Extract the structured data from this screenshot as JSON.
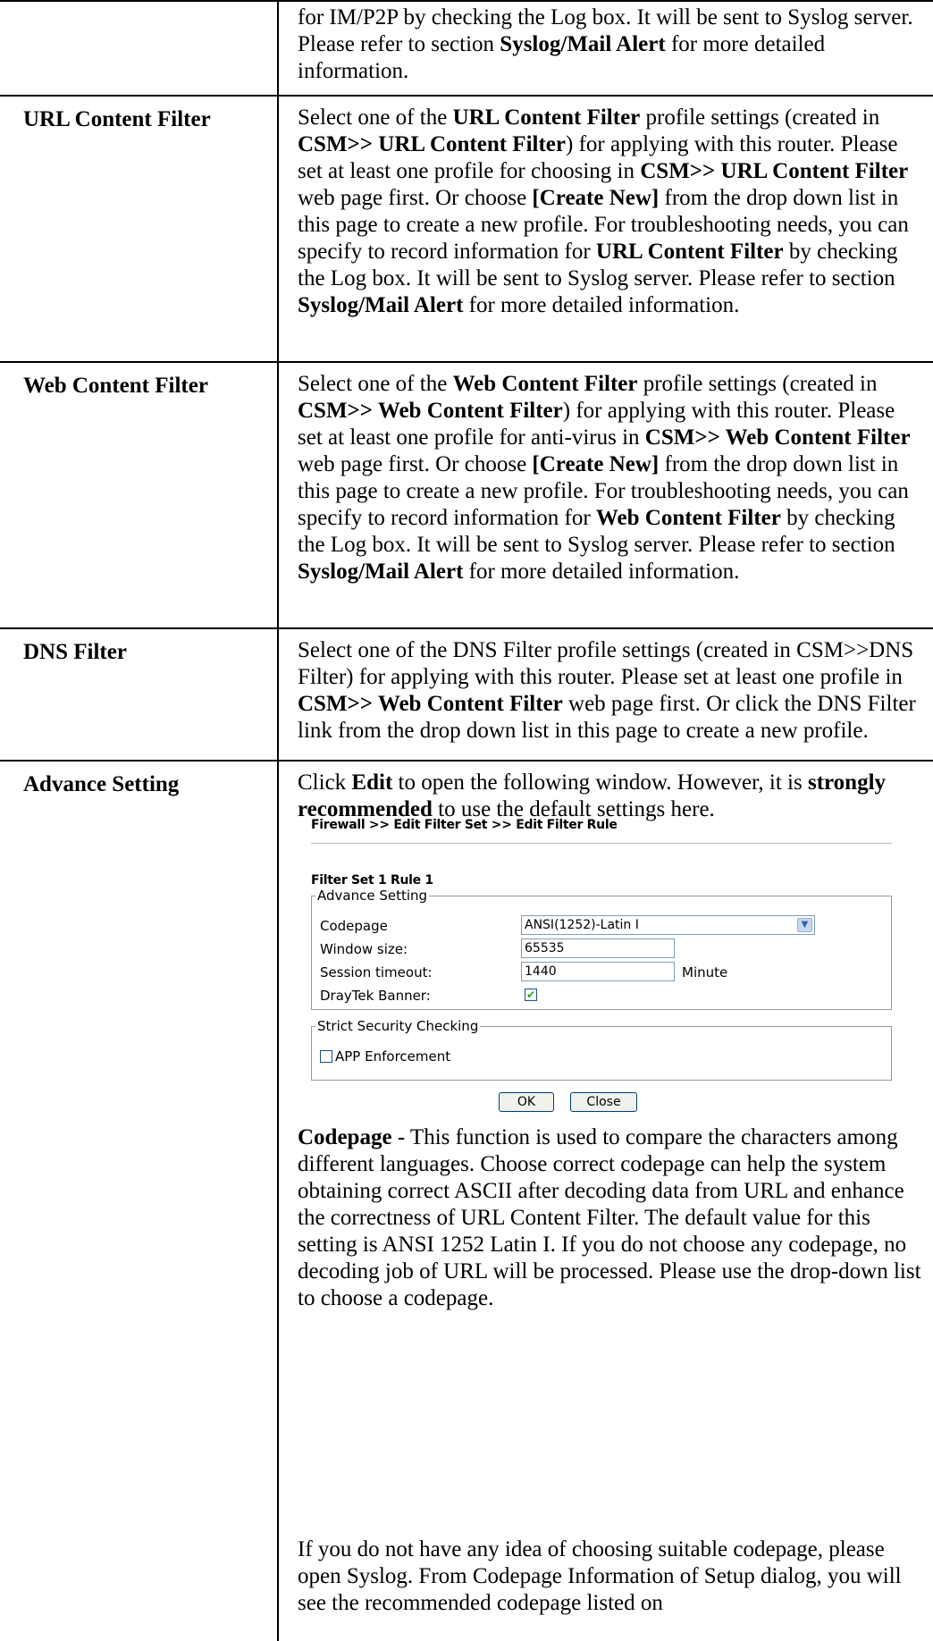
{
  "rows": [
    {
      "label": "",
      "desc_html": "for IM/P2P by checking the Log box. It will be sent to Syslog server. Please refer to section <b>Syslog/Mail Alert</b> for more detailed information."
    },
    {
      "label": "URL Content Filter",
      "desc_html": "Select one of the <b>URL Content Filter</b> profile settings (created in <b>CSM&gt;&gt; URL Content Filter</b>) for applying with this router. Please set at least one profile for choosing in <b>CSM&gt;&gt; URL Content Filter</b> web page first. Or choose <b>[Create New]</b> from the drop down list in this page to create a new profile. For troubleshooting needs, you can specify to record information for <b>URL Content Filter</b> by checking the Log box. It will be sent to Syslog server. Please refer to section <b>Syslog/Mail Alert</b> for more detailed information."
    },
    {
      "label": "Web Content Filter",
      "desc_html": "Select one of the <b>Web Content Filter</b> profile settings (created in <b>CSM&gt;&gt; Web Content Filter</b>) for applying with this router. Please set at least one profile for anti-virus in <b>CSM&gt;&gt; Web Content Filter</b> web page first. Or choose <b>[Create New]</b> from the drop down list in this page to create a new profile. For troubleshooting needs, you can specify to record information for <b>Web Content Filter</b> by checking the Log box. It will be sent to Syslog server. Please refer to section <b>Syslog/Mail Alert</b> for more detailed information."
    },
    {
      "label": "DNS Filter",
      "desc_html": "Select one of the DNS Filter profile settings (created in CSM&gt;&gt;DNS Filter) for applying with this router. Please set at least one profile in <b>CSM&gt;&gt; Web Content Filter</b> web page first. Or click the DNS Filter link from the drop down list in this page to create a new profile."
    },
    {
      "label": "Advance Setting",
      "intro_html": "Click <b>Edit</b> to open the following window. However, it is <b>strongly recommended</b> to use the default settings here.",
      "codepage_html": "<b>Codepage</b> - This function is used to compare the characters among different languages. Choose correct codepage can help the system obtaining correct ASCII after decoding data from URL and enhance the correctness of URL Content Filter. The default value for this setting is ANSI 1252 Latin I. If you do not choose any codepage, no decoding job of URL will be processed. Please use the drop-down list to choose a codepage.",
      "tail_html": "If you do not have any idea of choosing suitable codepage, please open Syslog. From Codepage Information of Setup dialog, you will see the recommended codepage listed on"
    }
  ],
  "dialog": {
    "breadcrumb": "Firewall >> Edit Filter Set >> Edit Filter Rule",
    "subtitle": "Filter Set 1 Rule 1",
    "advance_legend": "Advance Setting",
    "codepage_label": "Codepage",
    "codepage_value": "ANSI(1252)-Latin I",
    "window_size_label": "Window size:",
    "window_size_value": "65535",
    "session_timeout_label": "Session timeout:",
    "session_timeout_value": "1440",
    "session_timeout_unit": "Minute",
    "draytek_banner_label": "DrayTek Banner:",
    "draytek_banner_checked": true,
    "strict_legend": "Strict Security Checking",
    "app_enforcement_label": "APP Enforcement",
    "app_enforcement_checked": false,
    "ok_label": "OK",
    "close_label": "Close"
  }
}
